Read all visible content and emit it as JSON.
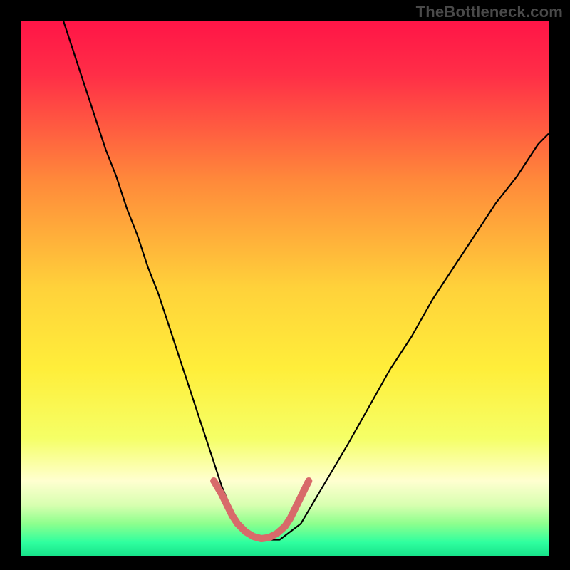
{
  "watermark": "TheBottleneck.com",
  "chart_data": {
    "type": "line",
    "title": "",
    "xlabel": "",
    "ylabel": "",
    "xlim": [
      0,
      100
    ],
    "ylim": [
      0,
      100
    ],
    "gradient_stops": [
      {
        "offset": 0.0,
        "color": "#ff1547"
      },
      {
        "offset": 0.1,
        "color": "#ff2e47"
      },
      {
        "offset": 0.3,
        "color": "#ff8a3a"
      },
      {
        "offset": 0.5,
        "color": "#ffd23a"
      },
      {
        "offset": 0.65,
        "color": "#ffee3a"
      },
      {
        "offset": 0.78,
        "color": "#f5ff66"
      },
      {
        "offset": 0.86,
        "color": "#ffffd0"
      },
      {
        "offset": 0.905,
        "color": "#d8ffb0"
      },
      {
        "offset": 0.94,
        "color": "#8dff8d"
      },
      {
        "offset": 0.975,
        "color": "#2fff9f"
      },
      {
        "offset": 1.0,
        "color": "#17e38a"
      }
    ],
    "series": [
      {
        "name": "primary-curve",
        "stroke": "#000000",
        "stroke_width": 2.2,
        "x": [
          8,
          10,
          12,
          14,
          16,
          18,
          20,
          22,
          24,
          26,
          28,
          30,
          32,
          34,
          36,
          38,
          41,
          45,
          49,
          53,
          56,
          59,
          62,
          66,
          70,
          74,
          78,
          82,
          86,
          90,
          94,
          98,
          100
        ],
        "y": [
          100,
          94,
          88,
          82,
          76,
          71,
          65,
          60,
          54,
          49,
          43,
          37,
          31,
          25,
          19,
          13,
          6,
          3,
          3,
          6,
          11,
          16,
          21,
          28,
          35,
          41,
          48,
          54,
          60,
          66,
          71,
          77,
          79
        ]
      },
      {
        "name": "trough-highlight",
        "stroke": "#d86a6a",
        "stroke_width": 10,
        "linecap": "round",
        "x": [
          36.5,
          38,
          39,
          40,
          41,
          42.5,
          44,
          45.5,
          47,
          48.5,
          50,
          51,
          52,
          53,
          54.5
        ],
        "y": [
          14,
          11.5,
          9.5,
          7.5,
          6,
          4.5,
          3.6,
          3.2,
          3.4,
          4.2,
          5.5,
          7,
          9,
          11,
          14
        ]
      }
    ]
  }
}
